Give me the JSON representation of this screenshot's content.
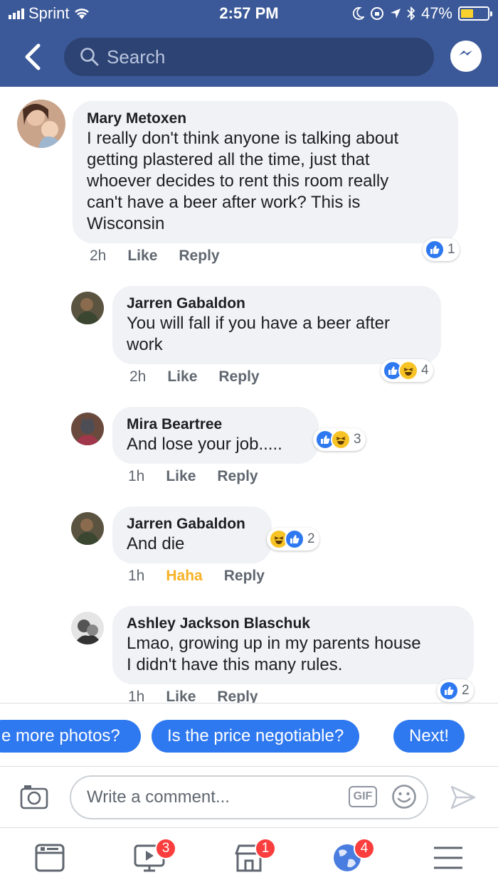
{
  "status_bar": {
    "carrier": "Sprint",
    "time": "2:57 PM",
    "battery": "47%",
    "battery_level": 0.47
  },
  "header": {
    "search_placeholder": "Search",
    "back_icon": "chevron-left-icon",
    "messenger_icon": "messenger-icon"
  },
  "comments": [
    {
      "name": "Mary Metoxen",
      "lines": [
        "I really don't think anyone is talking about",
        "getting plastered all the time, just that",
        "whoever decides to rent this room really",
        "can't have a beer after work? This is",
        "Wisconsin"
      ],
      "time": "2h",
      "like": "Like",
      "reply": "Reply",
      "reactions": "1"
    },
    {
      "name": "Jarren Gabaldon",
      "lines": [
        "You will fall if you have a beer after",
        "work"
      ],
      "time": "2h",
      "like": "Like",
      "reply": "Reply",
      "reactions": "4"
    },
    {
      "name": "Mira Beartree",
      "lines": [
        "And lose your job....."
      ],
      "time": "1h",
      "like": "Like",
      "reply": "Reply",
      "reactions": "3"
    },
    {
      "name": "Jarren Gabaldon",
      "lines": [
        "And die"
      ],
      "time": "1h",
      "like": "Haha",
      "reply": "Reply",
      "reactions": "2"
    },
    {
      "name": "Ashley Jackson Blaschuk",
      "lines": [
        "Lmao, growing up in my parents house",
        "I didn't have this many rules."
      ],
      "time": "1h",
      "like": "Like",
      "reply": "Reply",
      "reactions": "2"
    }
  ],
  "quick_replies": [
    "e more photos?",
    "Is the price negotiable?",
    "Next!"
  ],
  "composer": {
    "placeholder": "Write a comment...",
    "gif_label": "GIF"
  },
  "tab_bar": [
    {
      "icon": "news-feed-icon",
      "badge": ""
    },
    {
      "icon": "watch-icon",
      "badge": "3"
    },
    {
      "icon": "marketplace-icon",
      "badge": "1"
    },
    {
      "icon": "notifications-globe-icon",
      "badge": "4"
    },
    {
      "icon": "menu-icon",
      "badge": ""
    }
  ],
  "colors": {
    "header": "#3b5998",
    "accent": "#2e78f0",
    "haha": "#f7b125",
    "badge": "#fa3e3e"
  }
}
